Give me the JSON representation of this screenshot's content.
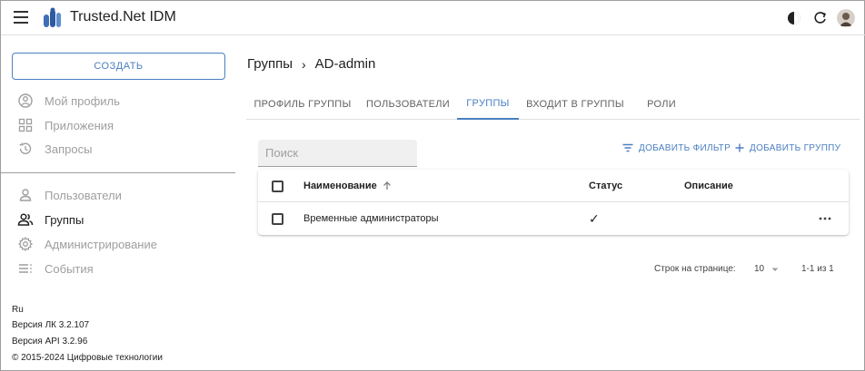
{
  "header": {
    "app_title": "Trusted.Net IDM",
    "icons": [
      "menu-icon",
      "app-logo",
      "theme-toggle-icon",
      "refresh-icon",
      "user-avatar"
    ]
  },
  "sidebar": {
    "create_label": "СОЗДАТЬ",
    "items": [
      {
        "label": "Мой профиль",
        "icon": "user-circle-icon"
      },
      {
        "label": "Приложения",
        "icon": "apps-grid-icon"
      },
      {
        "label": "Запросы",
        "icon": "history-icon"
      },
      {
        "label": "Пользователи",
        "icon": "user-icon"
      },
      {
        "label": "Группы",
        "icon": "group-icon"
      },
      {
        "label": "Администрирование",
        "icon": "gear-icon"
      },
      {
        "label": "События",
        "icon": "list-icon"
      }
    ],
    "active_item": "Группы",
    "footer": {
      "lang": "Ru",
      "version_lk": "Версия ЛК 3.2.107",
      "version_api": "Версия API 3.2.96",
      "copyright": "© 2015-2024 Цифровые технологии"
    }
  },
  "breadcrumb": {
    "parent": "Группы",
    "separator": "›",
    "current": "AD-admin"
  },
  "tabs": [
    {
      "label": "ПРОФИЛЬ ГРУППЫ",
      "active": false
    },
    {
      "label": "ПОЛЬЗОВАТЕЛИ",
      "active": false
    },
    {
      "label": "ГРУППЫ",
      "active": true
    },
    {
      "label": "ВХОДИТ В ГРУППЫ",
      "active": false
    },
    {
      "label": "РОЛИ",
      "active": false
    }
  ],
  "toolbar": {
    "search_placeholder": "Поиск",
    "search_value": "",
    "add_filter_label": "ДОБАВИТЬ ФИЛЬТР",
    "add_group_label": "ДОБАВИТЬ ГРУППУ"
  },
  "table": {
    "columns": [
      "Наименование",
      "Статус",
      "Описание"
    ],
    "sort_column": "Наименование",
    "sort_direction": "asc",
    "rows": [
      {
        "name": "Временные администраторы",
        "status": "✓",
        "description": "",
        "selected": false
      }
    ]
  },
  "pagination": {
    "rows_per_page_label": "Строк на странице:",
    "rows_per_page": "10",
    "range": "1-1 из 1"
  },
  "colors": {
    "accent": "#4a7fc1",
    "text": "#212121",
    "muted": "#9e9e9e"
  }
}
